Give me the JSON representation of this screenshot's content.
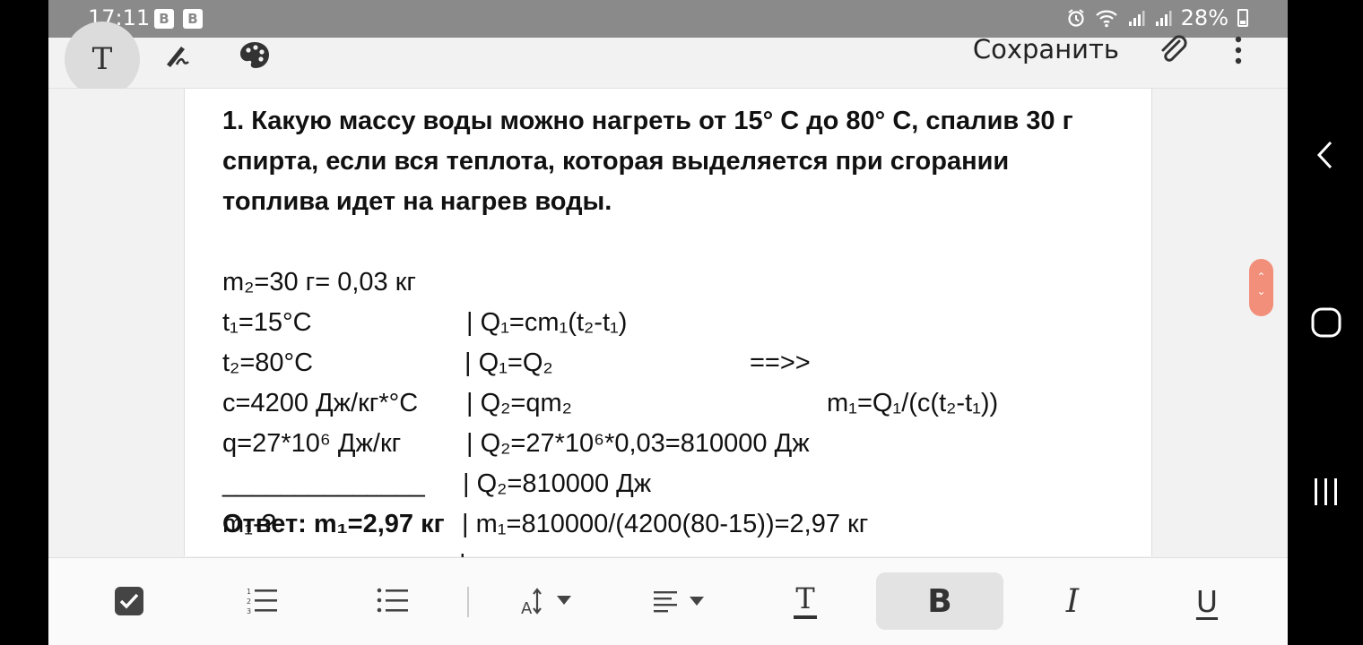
{
  "status_bar": {
    "time": "17:11",
    "notif_badges": [
      "B",
      "B"
    ],
    "battery": "28%"
  },
  "toolbar": {
    "text_mode_icon": "T",
    "save_label": "Сохранить"
  },
  "document": {
    "question": [
      "1. Какую массу воды можно нагреть от 15° С до 80° С, спалив 30 г",
      "спирта, если вся теплота, которая выделяется при сгорании",
      "топлива идет на нагрев воды."
    ],
    "rows": [
      {
        "given": "m₂=30 г= 0,03 кг",
        "solution": "| Q₁=cm₁(t₂-t₁)",
        "arrow": "==>>",
        "result": "m₁=Q₁/(c(t₂-t₁))"
      },
      {
        "given": "t₁=15°C",
        "solution": "| Q₁=Q₂",
        "arrow": "",
        "result": ""
      },
      {
        "given": "t₂=80°C",
        "solution": "| Q₂=qm₂",
        "arrow": "",
        "result": ""
      },
      {
        "given": "c=4200 Дж/кг*°C",
        "solution": "| Q₂=27*10⁶*0,03=810000 Дж",
        "arrow": "",
        "result": ""
      },
      {
        "given": "q=27*10⁶ Дж/кг",
        "solution": "| Q₂=810000 Дж",
        "arrow": "",
        "result": ""
      },
      {
        "given": "______________",
        "solution": "| m₁=810000/(4200(80-15))=2,97 кг",
        "arrow": "",
        "result": ""
      },
      {
        "given": "m₁-?",
        "solution": "|",
        "arrow": "",
        "result": ""
      }
    ],
    "answer": "Ответ: m₁=2,97 кг"
  },
  "format_bar": {
    "bold_label": "B",
    "italic_label": "I",
    "underline_label": "U",
    "text_color_label": "T"
  },
  "colors": {
    "scroll_handle": "#f28f7a",
    "status_bar": "#8a8a8a",
    "page": "#ffffff"
  }
}
